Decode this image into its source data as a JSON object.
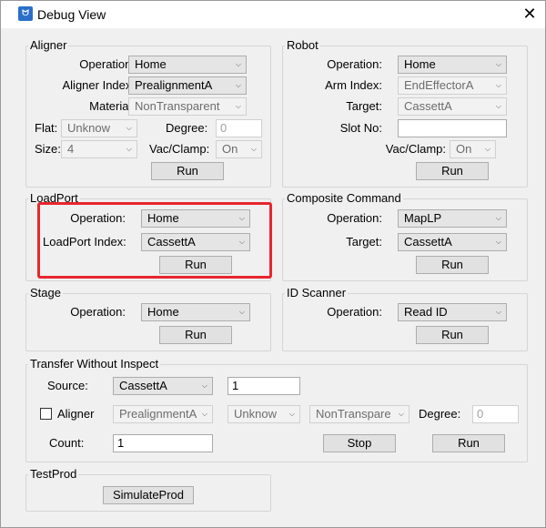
{
  "window": {
    "title": "Debug View",
    "icon": "app-icon",
    "close": "✕"
  },
  "aligner": {
    "title": "Aligner",
    "operation_label": "Operation:",
    "operation_value": "Home",
    "index_label": "Aligner Index:",
    "index_value": "PrealignmentA",
    "material_label": "Material:",
    "material_value": "NonTransparent",
    "flat_label": "Flat:",
    "flat_value": "Unknow",
    "degree_label": "Degree:",
    "degree_value": "0",
    "size_label": "Size:",
    "size_value": "4",
    "vac_label": "Vac/Clamp:",
    "vac_value": "On",
    "run": "Run"
  },
  "robot": {
    "title": "Robot",
    "operation_label": "Operation:",
    "operation_value": "Home",
    "arm_label": "Arm Index:",
    "arm_value": "EndEffectorA",
    "target_label": "Target:",
    "target_value": "CassettA",
    "slot_label": "Slot No:",
    "slot_value": "",
    "vac_label": "Vac/Clamp:",
    "vac_value": "On",
    "run": "Run"
  },
  "loadport": {
    "title": "LoadPort",
    "operation_label": "Operation:",
    "operation_value": "Home",
    "index_label": "LoadPort Index:",
    "index_value": "CassettA",
    "run": "Run"
  },
  "composite": {
    "title": "Composite Command",
    "operation_label": "Operation:",
    "operation_value": "MapLP",
    "target_label": "Target:",
    "target_value": "CassettA",
    "run": "Run"
  },
  "stage": {
    "title": "Stage",
    "operation_label": "Operation:",
    "operation_value": "Home",
    "run": "Run"
  },
  "idscanner": {
    "title": "ID Scanner",
    "operation_label": "Operation:",
    "operation_value": "Read ID",
    "run": "Run"
  },
  "transfer": {
    "title": "Transfer Without Inspect",
    "source_label": "Source:",
    "source_value": "CassettA",
    "source_slot": "1",
    "aligner_label": "Aligner",
    "aligner_checked": false,
    "aligner_index": "PrealignmentA",
    "flat": "Unknow",
    "material": "NonTranspare",
    "degree_label": "Degree:",
    "degree_value": "0",
    "count_label": "Count:",
    "count_value": "1",
    "stop": "Stop",
    "run": "Run"
  },
  "testprod": {
    "title": "TestProd",
    "simulate": "SimulateProd"
  },
  "colors": {
    "highlight": "#e8262e"
  }
}
